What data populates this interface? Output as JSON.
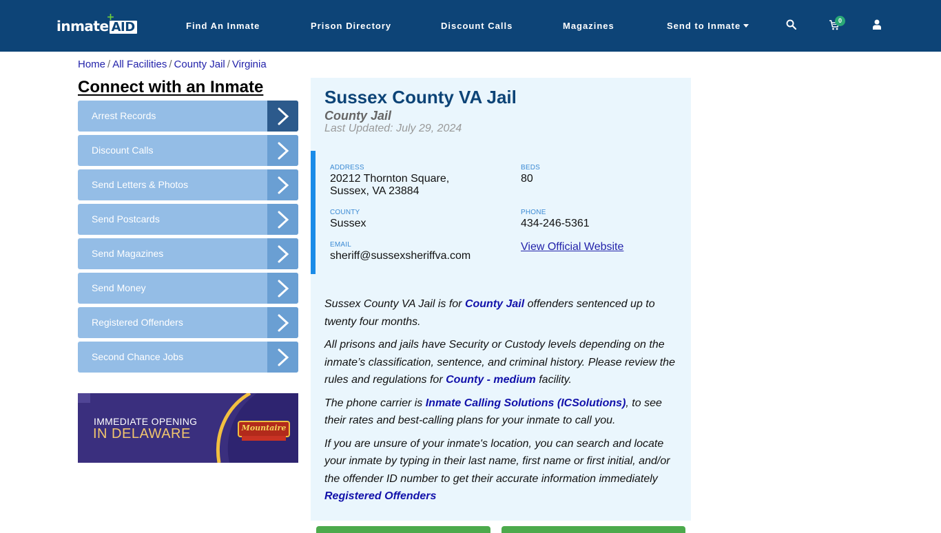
{
  "header": {
    "logo": {
      "text_main": "inmate",
      "text_box": "AID",
      "plus": "+"
    },
    "nav": [
      {
        "label": "Find An Inmate"
      },
      {
        "label": "Prison Directory"
      },
      {
        "label": "Discount Calls"
      },
      {
        "label": "Magazines"
      },
      {
        "label": "Send to Inmate",
        "dropdown": true
      }
    ],
    "icons": {
      "search": "search-icon",
      "cart": "cart-icon",
      "user": "user-icon"
    },
    "cart_count": "0"
  },
  "breadcrumb": [
    {
      "label": "Home"
    },
    {
      "label": "All Facilities"
    },
    {
      "label": "County Jail"
    },
    {
      "label": "Virginia"
    }
  ],
  "breadcrumb_separator": "/",
  "sidebar": {
    "title": "Connect with an Inmate",
    "items": [
      {
        "label": "Arrest Records",
        "active": true
      },
      {
        "label": "Discount Calls"
      },
      {
        "label": "Send Letters & Photos"
      },
      {
        "label": "Send Postcards"
      },
      {
        "label": "Send Magazines"
      },
      {
        "label": "Send Money"
      },
      {
        "label": "Registered Offenders"
      },
      {
        "label": "Second Chance Jobs"
      }
    ],
    "ad": {
      "line1": "IMMEDIATE OPENING",
      "line2": "IN DELAWARE",
      "brand": "Mountaire"
    }
  },
  "facility": {
    "name": "Sussex County VA Jail",
    "type": "County Jail",
    "last_updated": "Last Updated: July 29, 2024",
    "fields": {
      "address_label": "ADDRESS",
      "address_line1": "20212 Thornton Square,",
      "address_line2": "Sussex, VA 23884",
      "beds_label": "BEDS",
      "beds": "80",
      "county_label": "COUNTY",
      "county": "Sussex",
      "phone_label": "PHONE",
      "phone": "434-246-5361",
      "email_label": "EMAIL",
      "email": "sheriff@sussexsheriffva.com",
      "website_link": "View Official Website"
    },
    "description": {
      "p1_pre": "Sussex County VA Jail is for ",
      "p1_link": "County Jail",
      "p1_post": " offenders sentenced up to twenty four months.",
      "p2_pre": "All prisons and jails have Security or Custody levels depending on the inmate’s classification, sentence, and criminal history. Please review the rules and regulations for ",
      "p2_link": "County - medium",
      "p2_post": " facility.",
      "p3_pre": "The phone carrier is ",
      "p3_link": "Inmate Calling Solutions (ICSolutions)",
      "p3_post": ", to see their rates and best-calling plans for your inmate to call you.",
      "p4_text": "If you are unsure of your inmate's location, you can search and locate your inmate by typing in their last name, first name or first initial, and/or the offender ID number to get their accurate information immediately",
      "p4_link": "Registered Offenders"
    }
  },
  "colors": {
    "header_bg": "#0d4477",
    "sidebar_item": "#94bde6",
    "sidebar_arrow": "#6a9fd3",
    "sidebar_arrow_active": "#2c5a8c",
    "panel_bg": "#eaf6fd",
    "accent_bar": "#1a8be8",
    "link": "#1111aa",
    "button_green": "#4caa4c"
  }
}
